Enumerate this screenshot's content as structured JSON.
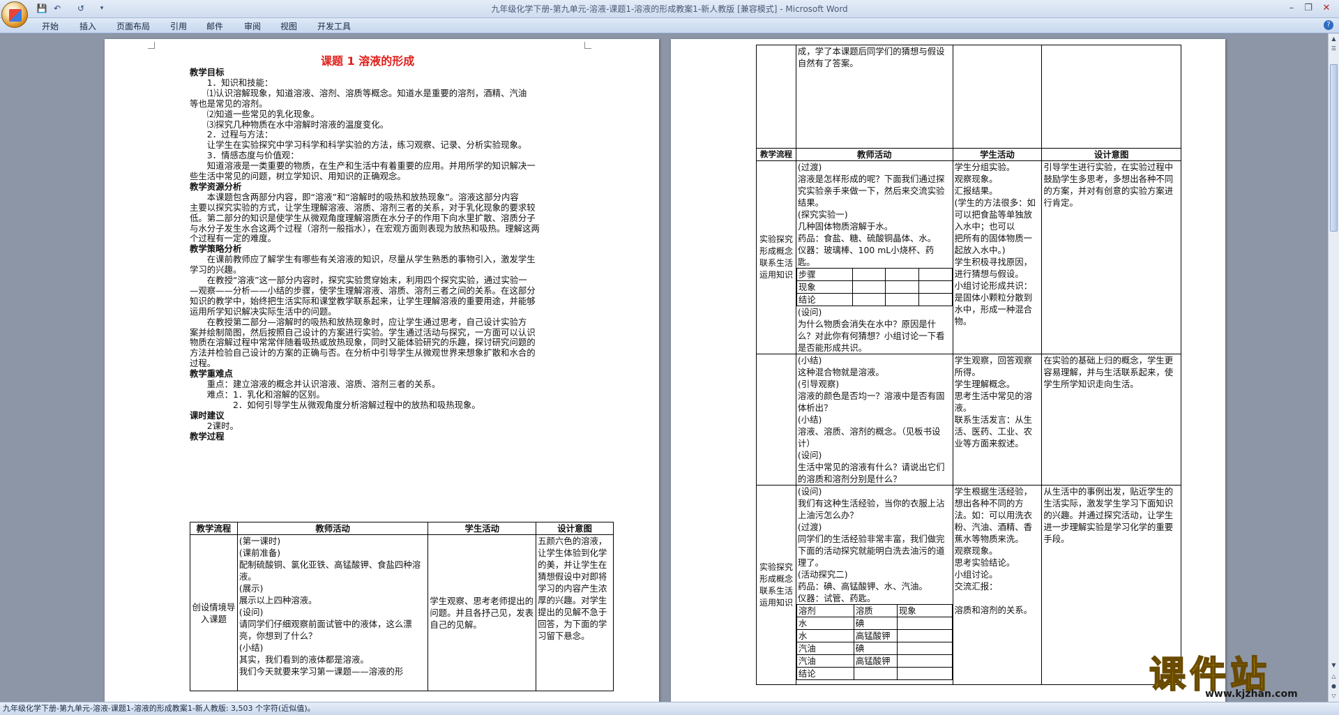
{
  "window": {
    "title": "九年级化学下册-第九单元-溶液-课题1-溶液的形成教案1-新人教版 [兼容模式] - Microsoft Word",
    "qat": [
      "save-icon",
      "undo-icon",
      "redo-icon",
      "customize-icon"
    ]
  },
  "ribbon": {
    "tabs": [
      "开始",
      "插入",
      "页面布局",
      "引用",
      "邮件",
      "审阅",
      "视图",
      "开发工具"
    ]
  },
  "status": {
    "text": "九年级化学下册-第九单元-溶液-课题1-溶液的形成教案1-新人教版: 3,503 个字符(近似值)。"
  },
  "watermark": {
    "text": "课件站",
    "url": "www.kjzhan.com"
  },
  "page1": {
    "title": "课题 1    溶液的形成",
    "lines": [
      {
        "t": "教学目标",
        "b": true,
        "i": 0
      },
      {
        "t": "1．知识和技能：",
        "i": 2
      },
      {
        "t": "⑴认识溶解现象，知道溶液、溶剂、溶质等概念。知道水是重要的溶剂，酒精、汽油",
        "i": 2
      },
      {
        "t": "等也是常见的溶剂。",
        "i": 0
      },
      {
        "t": "⑵知道一些常见的乳化现象。",
        "i": 2
      },
      {
        "t": "⑶探究几种物质在水中溶解时溶液的温度变化。",
        "i": 2
      },
      {
        "t": "2．过程与方法：",
        "i": 2
      },
      {
        "t": "让学生在实验探究中学习科学和科学实验的方法，练习观察、记录、分析实验现象。",
        "i": 2
      },
      {
        "t": "3．情感态度与价值观：",
        "i": 2
      },
      {
        "t": "知道溶液是一类重要的物质，在生产和生活中有着重要的应用。并用所学的知识解决一",
        "i": 2
      },
      {
        "t": "些生活中常见的问题，树立学知识、用知识的正确观念。",
        "i": 0
      },
      {
        "t": "教学资源分析",
        "b": true,
        "i": 0
      },
      {
        "t": "本课题包含两部分内容，即“溶液”和“溶解时的吸热和放热现象”。溶液这部分内容",
        "i": 2
      },
      {
        "t": "主要以探究实验的方式，让学生理解溶液、溶质、溶剂三者的关系，对于乳化现象的要求较",
        "i": 0
      },
      {
        "t": "低。第二部分的知识是使学生从微观角度理解溶质在水分子的作用下向水里扩散、溶质分子",
        "i": 0
      },
      {
        "t": "与水分子发生水合这两个过程（溶剂一般指水），在宏观方面则表现为放热和吸热。理解这两",
        "i": 0
      },
      {
        "t": "个过程有一定的难度。",
        "i": 0
      },
      {
        "t": "教学策略分析",
        "b": true,
        "i": 0
      },
      {
        "t": "在课前教师应了解学生有哪些有关溶液的知识，尽量从学生熟悉的事物引入，激发学生",
        "i": 2
      },
      {
        "t": "学习的兴趣。",
        "i": 0
      },
      {
        "t": "在教授“溶液”这一部分内容时，探究实验贯穿始末，利用四个探究实验，通过实验一",
        "i": 2
      },
      {
        "t": "—观察——分析——小结的步骤，使学生理解溶液、溶质、溶剂三者之间的关系。在这部分",
        "i": 0
      },
      {
        "t": "知识的教学中，始终把生活实际和课堂教学联系起来，让学生理解溶液的重要用途，并能够",
        "i": 0
      },
      {
        "t": "运用所学知识解决实际生活中的问题。",
        "i": 0
      },
      {
        "t": "在教授第二部分—溶解时的吸热和放热现象时，应让学生通过思考，自己设计实验方",
        "i": 2
      },
      {
        "t": "案并绘制简图，然后按照自己设计的方案进行实验。学生通过活动与探究，一方面可以认识",
        "i": 0
      },
      {
        "t": "物质在溶解过程中常常伴随着吸热或放热现象，同时又能体验研究的乐趣，探讨研究问题的",
        "i": 0
      },
      {
        "t": "方法并检验自己设计的方案的正确与否。在分析中引导学生从微观世界来想象扩散和水合的",
        "i": 0
      },
      {
        "t": "过程。",
        "i": 0
      },
      {
        "t": "教学重难点",
        "b": true,
        "i": 0
      },
      {
        "t": "重点：建立溶液的概念并认识溶液、溶质、溶剂三者的关系。",
        "i": 2
      },
      {
        "t": "难点：1．乳化和溶解的区别。",
        "i": 2
      },
      {
        "t": "2．如何引导学生从微观角度分析溶解过程中的放热和吸热现象。",
        "i": 5
      },
      {
        "t": "课时建议",
        "b": true,
        "i": 0
      },
      {
        "t": "2课时。",
        "i": 2
      },
      {
        "t": "教学过程",
        "b": true,
        "i": 0
      }
    ],
    "table": {
      "headers": [
        "教学流程",
        "教师活动",
        "学生活动",
        "设计意图"
      ],
      "row": {
        "flow": "创设情境导入课题",
        "teacher": [
          "(第一课时)",
          "(课前准备)",
          "配制硫酸铜、氯化亚铁、高锰酸钾、食盐四种溶液。",
          "(展示)",
          "展示以上四种溶液。",
          "(设问)",
          "请同学们仔细观察前面试管中的液体，这么漂亮，你想到了什么？",
          "(小结)",
          "其实，我们看到的液体都是溶液。",
          "我们今天就要来学习第一课题——溶液的形"
        ],
        "student": "学生观察、思考老师提出的问题。并且各抒己见，发表自己的见解。",
        "intent": "五颜六色的溶液，让学生体验到化学的美，并让学生在猜想假设中对即将学习的内容产生浓厚的兴趣。对学生提出的见解不急于回答，为下面的学习留下悬念。"
      }
    }
  },
  "page2": {
    "top_row": {
      "teacher": "成，学了本课题后同学们的猜想与假设自然有了答案。"
    },
    "headers": [
      "教学流程",
      "教师活动",
      "学生活动",
      "设计意图"
    ],
    "rows": [
      {
        "flow": "实验探究形成概念联系生活运用知识",
        "teacher_a": [
          "(过渡)",
          "溶液是怎样形成的呢？下面我们通过探究实验亲手来做一下，然后来交流实验结果。",
          "(探究实验一)",
          "几种固体物质溶解于水。",
          "药品：食盐、糖、硫酸铜晶体、水。",
          "仪器：玻璃棒、100 mL小烧杯、药匙。"
        ],
        "grid": [
          "步骤",
          "现象",
          "结论"
        ],
        "teacher_b": [
          "(设问)",
          "为什么物质会消失在水中？原因是什么？对此你有何猜想？小组讨论一下看是否能形成共识。"
        ],
        "student": [
          "学生分组实验。",
          "观察现象。",
          "汇报结果。",
          "(学生的方法很多：如可以把食盐等单独放入水中；也可以",
          "把所有的固体物质一起放入水中。)",
          "学生积极寻找原因，进行猜想与假设。",
          "小组讨论形成共识：是固体小颗粒分散到水中，形成一种混合物。"
        ],
        "intent": "引导学生进行实验，在实验过程中鼓励学生多思考，多想出各种不同的方案，并对有创意的实验方案进行肯定。"
      },
      {
        "teacher": [
          "(小结)",
          "这种混合物就是溶液。",
          "(引导观察)",
          "溶液的颜色是否均一？溶液中是否有固体析出？",
          "(小结)",
          "溶液、溶质、溶剂的概念。（见板书设计）",
          "(设问)",
          "生活中常见的溶液有什么？请说出它们的溶质和溶剂分别是什么？"
        ],
        "student": [
          "学生观察，回答观察所得。",
          "学生理解概念。",
          "思考生活中常见的溶液。",
          "联系生活发言：从生活、医药、工业、农业等方面来叙述。"
        ],
        "intent": "在实验的基础上归的概念，学生更容易理解，并与生活联系起来，使学生所学知识走向生活。"
      },
      {
        "flow": "实验探究形成概念联系生活运用知识",
        "teacher_a": [
          "(设问)",
          "我们有这种生活经验，当你的衣服上沾上油污怎么办？",
          "(过渡)",
          "同学们的生活经验非常丰富，我们做完下面的活动探究就能明白洗去油污的道理了。",
          "(活动探究二)",
          "药品：碘、高锰酸钾、水、汽油。",
          "仪器：试管、药匙。"
        ],
        "grid_head": [
          "溶剂",
          "溶质",
          "现象"
        ],
        "grid_rows": [
          [
            "水",
            "碘",
            ""
          ],
          [
            "水",
            "高锰酸钾",
            ""
          ],
          [
            "汽油",
            "碘",
            ""
          ],
          [
            "汽油",
            "高锰酸钾",
            ""
          ]
        ],
        "grid_last": "结论",
        "student": [
          "学生根据生活经验，想出各种不同的方法。如：可以用洗衣粉、汽油、酒精、香蕉水等物质来洗。",
          "观察现象。",
          "思考实验结论。",
          "小组讨论。",
          "交流汇报：",
          "",
          "溶质和溶剂的关系。"
        ],
        "intent": "从生活中的事例出发，贴近学生的生活实际，激发学生学习下面知识的兴趣。并通过探究活动，让学生进一步理解实验是学习化学的重要手段。"
      }
    ]
  }
}
